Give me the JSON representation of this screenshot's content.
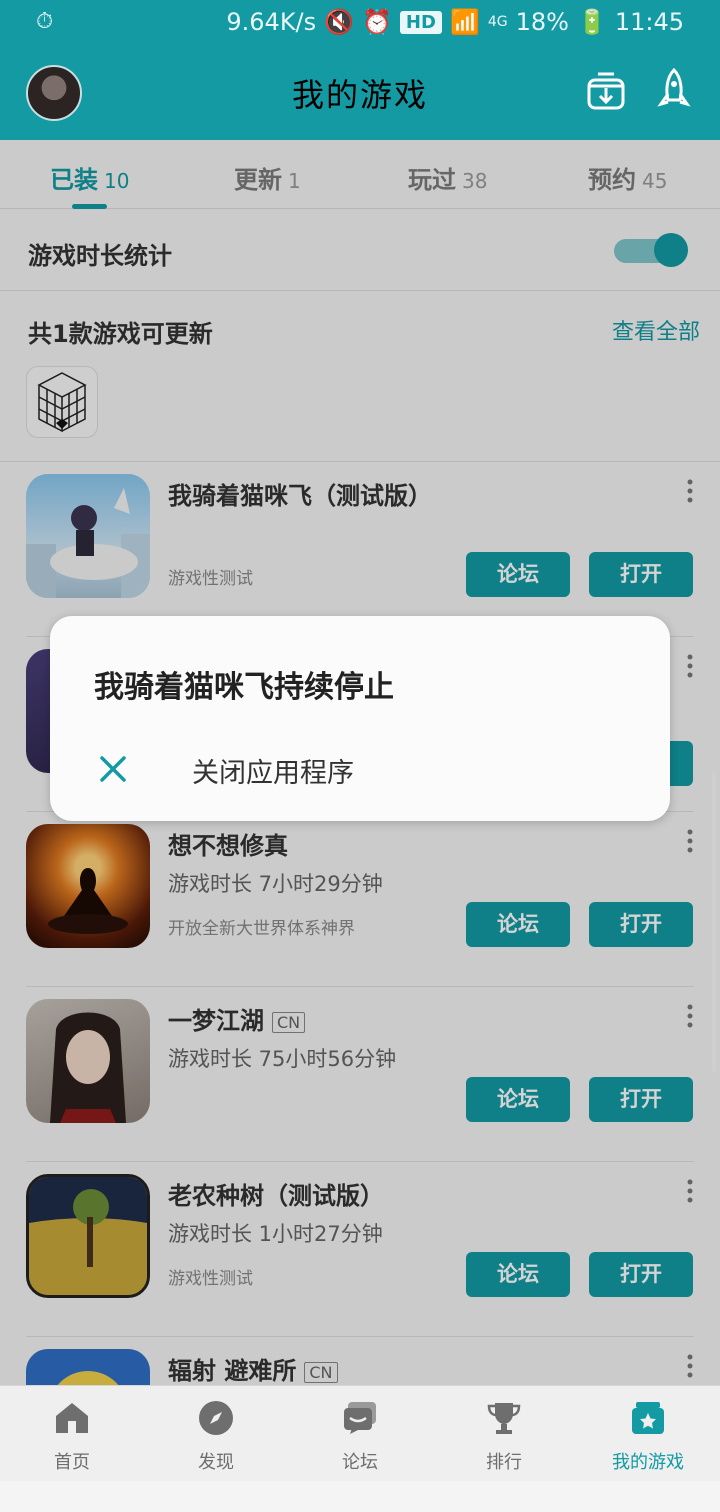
{
  "colors": {
    "accent": "#139aa3",
    "header_bg": "#139aa3"
  },
  "status_bar": {
    "net_speed": "9.64K/s",
    "hd": "HD",
    "signal": "4G",
    "battery": "18%",
    "time": "11:45"
  },
  "header": {
    "title": "我的游戏"
  },
  "tabs": [
    {
      "label": "已装",
      "count": "10"
    },
    {
      "label": "更新",
      "count": "1"
    },
    {
      "label": "玩过",
      "count": "38"
    },
    {
      "label": "预约",
      "count": "45"
    }
  ],
  "stats": {
    "label": "游戏时长统计",
    "enabled": true
  },
  "updates": {
    "label": "共1款游戏可更新",
    "view_all": "查看全部"
  },
  "games": [
    {
      "name": "我骑着猫咪飞（测试版）",
      "tag": "",
      "playtime": "",
      "desc": "游戏性测试",
      "forum": "论坛",
      "open": "打开"
    },
    {
      "name": "",
      "tag": "",
      "playtime": "",
      "desc": "",
      "forum": "",
      "open": ""
    },
    {
      "name": "想不想修真",
      "tag": "",
      "playtime": "游戏时长  7小时29分钟",
      "desc": "开放全新大世界体系神界",
      "forum": "论坛",
      "open": "打开"
    },
    {
      "name": "一梦江湖",
      "tag": "CN",
      "playtime": "游戏时长  75小时56分钟",
      "desc": "",
      "forum": "论坛",
      "open": "打开"
    },
    {
      "name": "老农种树（测试版）",
      "tag": "",
      "playtime": "游戏时长  1小时27分钟",
      "desc": "游戏性测试",
      "forum": "论坛",
      "open": "打开"
    },
    {
      "name": "辐射 避难所",
      "tag": "CN",
      "playtime": "",
      "desc": "",
      "forum": "",
      "open": ""
    }
  ],
  "dialog": {
    "title": "我骑着猫咪飞持续停止",
    "close_label": "关闭应用程序"
  },
  "bottom_nav": [
    {
      "label": "首页",
      "icon": "home-icon"
    },
    {
      "label": "发现",
      "icon": "compass-icon"
    },
    {
      "label": "论坛",
      "icon": "forum-icon"
    },
    {
      "label": "排行",
      "icon": "trophy-icon"
    },
    {
      "label": "我的游戏",
      "icon": "my-games-icon"
    }
  ]
}
